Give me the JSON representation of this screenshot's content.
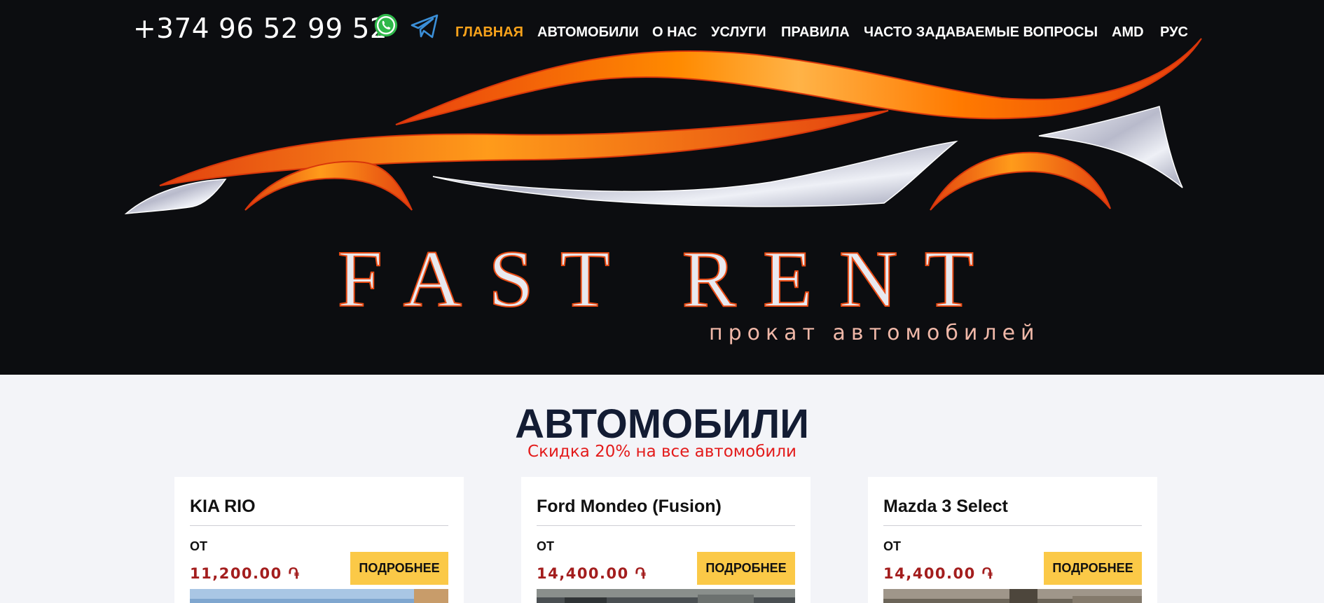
{
  "header": {
    "phone": "+374 96 52 99 52",
    "social_icons": [
      "whatsapp-icon",
      "telegram-icon"
    ],
    "nav": [
      {
        "label": "ГЛАВНАЯ",
        "active": true
      },
      {
        "label": "АВТОМОБИЛИ",
        "active": false
      },
      {
        "label": "О НАС",
        "active": false
      },
      {
        "label": "УСЛУГИ",
        "active": false
      },
      {
        "label": "ПРАВИЛА",
        "active": false
      },
      {
        "label": "ЧАСТО ЗАДАВАЕМЫЕ ВОПРОСЫ",
        "active": false
      }
    ],
    "currency": "AMD",
    "language": "РУС"
  },
  "hero": {
    "brand": "FAST RENT",
    "tagline": "прокат автомобилей"
  },
  "cars_section": {
    "title": "АВТОМОБИЛИ",
    "subtitle": "Скидка 20% на все автомобили",
    "cards": [
      {
        "title": "KIA RIO",
        "from_label": "ОТ",
        "price": "11,200.00 ֏",
        "button": "ПОДРОБНЕЕ"
      },
      {
        "title": "Ford Mondeo (Fusion)",
        "from_label": "ОТ",
        "price": "14,400.00 ֏",
        "button": "ПОДРОБНЕЕ"
      },
      {
        "title": "Mazda 3 Select",
        "from_label": "ОТ",
        "price": "14,400.00 ֏",
        "button": "ПОДРОБНЕЕ"
      }
    ]
  },
  "colors": {
    "hero_bg": "#0c0d10",
    "accent_orange": "#f7a21b",
    "brand_outline": "#e94b14",
    "title_navy": "#131c33",
    "discount_red": "#e31b1b",
    "price_red": "#a31d1d",
    "button_yellow": "#fbc947",
    "page_bg": "#f3f4f8"
  }
}
